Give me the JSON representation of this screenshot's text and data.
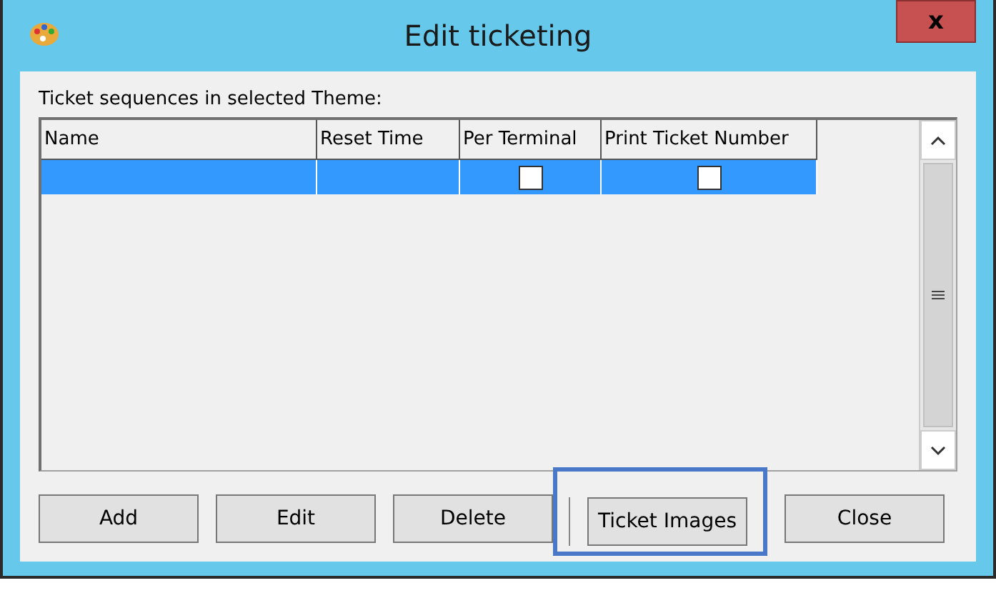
{
  "window": {
    "title": "Edit ticketing",
    "close_label": "x"
  },
  "list_label": "Ticket sequences in selected Theme:",
  "table": {
    "columns": [
      "Name",
      "Reset Time",
      "Per Terminal",
      "Print Ticket Number"
    ],
    "rows": [
      {
        "selected": true,
        "per_terminal": false,
        "print_ticket_number": false
      }
    ]
  },
  "buttons": [
    {
      "kind": "button",
      "label": "Add",
      "highlighted": false
    },
    {
      "kind": "button",
      "label": "Edit",
      "highlighted": false
    },
    {
      "kind": "button",
      "label": "Delete",
      "highlighted": false
    },
    {
      "kind": "separator"
    },
    {
      "kind": "button",
      "label": "Ticket Images",
      "highlighted": true
    },
    {
      "kind": "button",
      "label": "Close",
      "highlighted": false
    }
  ]
}
